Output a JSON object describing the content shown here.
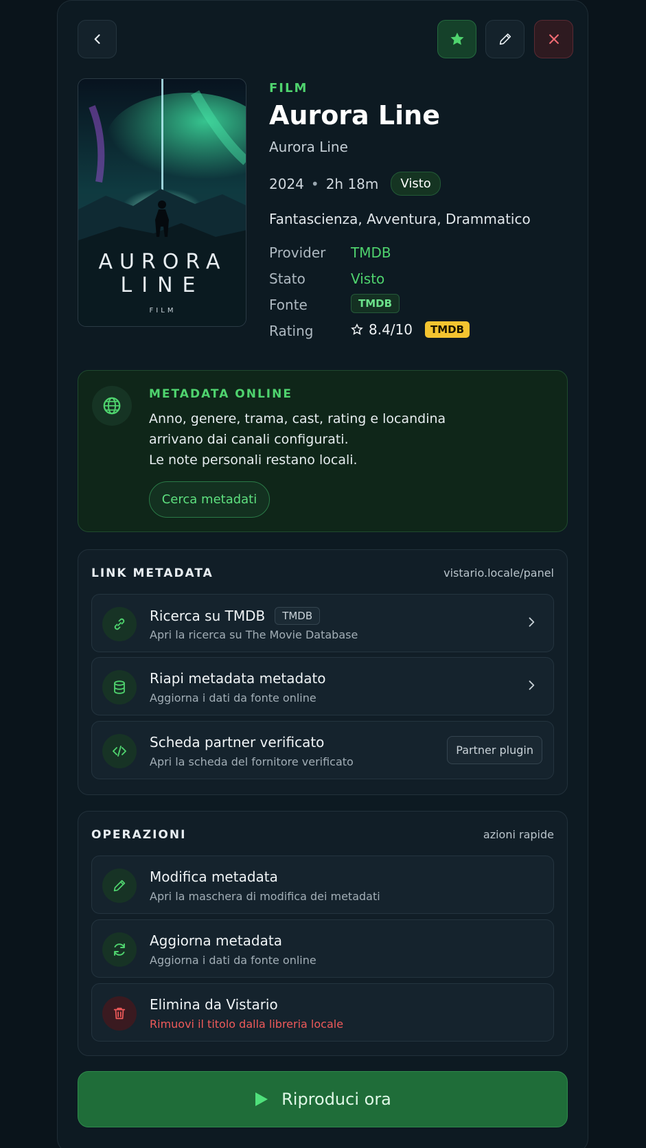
{
  "header": {
    "back_icon": "chevron-left-icon",
    "favorite_icon": "star-icon",
    "edit_icon": "pencil-icon",
    "close_icon": "close-icon"
  },
  "poster": {
    "title_line1": "AURORA",
    "title_line2": "LINE",
    "subtitle": "FILM"
  },
  "item": {
    "kind": "FILM",
    "title": "Aurora Line",
    "original_title": "Aurora Line",
    "year": "2024",
    "separator": "•",
    "duration": "2h 18m",
    "status_badge": "Visto",
    "genres": "Fantascienza, Avventura, Drammatico"
  },
  "details": {
    "provider_label": "Provider",
    "provider_value": "TMDB",
    "stato_label": "Stato",
    "stato_value": "Visto",
    "fonte_label": "Fonte",
    "fonte_value": "TMDB",
    "rating_label": "Rating",
    "rating_value": "8.4/10",
    "rating_source": "TMDB"
  },
  "online": {
    "title": "METADATA ONLINE",
    "line1": "Anno, genere, trama, cast, rating e locandina",
    "line2": "arrivano dai canali configurati.",
    "line3": "Le note personali restano locali.",
    "button": "Cerca metadati"
  },
  "links": {
    "heading": "LINK METADATA",
    "right": "vistario.locale/panel",
    "items": [
      {
        "title": "Ricerca su TMDB",
        "tag": "TMDB",
        "subtitle": "Apri la ricerca su The Movie Database",
        "icon": "link-icon"
      },
      {
        "title": "Riapi metadata metadato",
        "subtitle": "Aggiorna i dati da fonte online",
        "icon": "database-icon"
      },
      {
        "title": "Scheda partner verificato",
        "subtitle": "Apri la scheda del fornitore verificato",
        "button": "Partner plugin",
        "icon": "code-icon"
      }
    ]
  },
  "operations": {
    "heading": "OPERAZIONI",
    "right": "azioni rapide",
    "items": [
      {
        "title": "Modifica metadata",
        "subtitle": "Apri la maschera di modifica dei metadati",
        "icon": "pencil-icon"
      },
      {
        "title": "Aggiorna metadata",
        "subtitle": "Aggiorna i dati da fonte online",
        "icon": "refresh-icon"
      },
      {
        "title": "Elimina da Vistario",
        "subtitle": "Rimuovi il titolo dalla libreria locale",
        "icon": "trash-icon"
      }
    ]
  },
  "play": {
    "label": "Riproduci ora",
    "icon": "play-icon"
  },
  "colors": {
    "accent": "#4fd36e",
    "background": "#0a141b",
    "danger": "#ef5a5a",
    "rating_badge": "#f4c430",
    "play_button": "#1f6d39"
  }
}
